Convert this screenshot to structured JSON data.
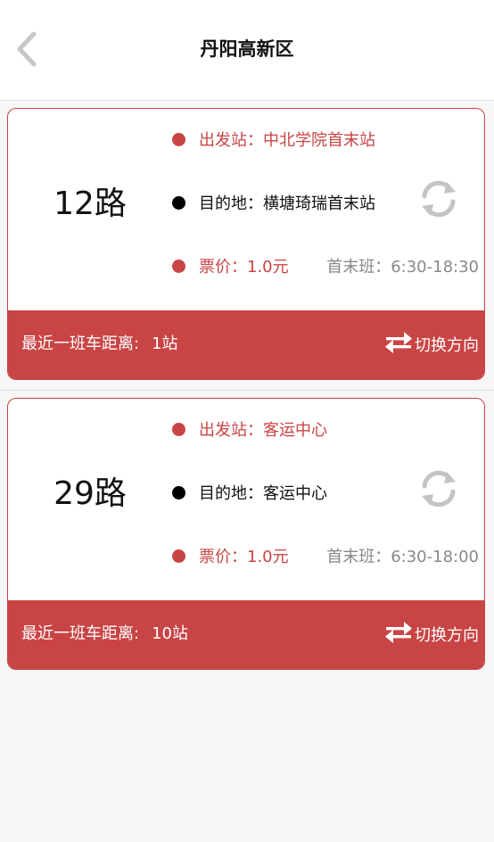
{
  "header": {
    "title": "丹阳高新区",
    "back_icon": "chevron-left-icon"
  },
  "colors": {
    "accent": "#c94444",
    "schedule_text": "#888888"
  },
  "routes": [
    {
      "name": "12路",
      "depart_label": "出发站：",
      "depart": "中北学院首末站",
      "dest_label": "目的地：",
      "dest": "横塘琦瑞首末站",
      "price_label": "票价：",
      "price": "1.0元",
      "schedule_label": "首末班：",
      "schedule": "6:30-18:30",
      "nearest_label": "最近一班车距离:",
      "nearest": "1站",
      "switch_label": "切换方向"
    },
    {
      "name": "29路",
      "depart_label": "出发站：",
      "depart": "客运中心",
      "dest_label": "目的地：",
      "dest": "客运中心",
      "price_label": "票价：",
      "price": "1.0元",
      "schedule_label": "首末班：",
      "schedule": "6:30-18:00",
      "nearest_label": "最近一班车距离:",
      "nearest": "10站",
      "switch_label": "切换方向"
    }
  ]
}
